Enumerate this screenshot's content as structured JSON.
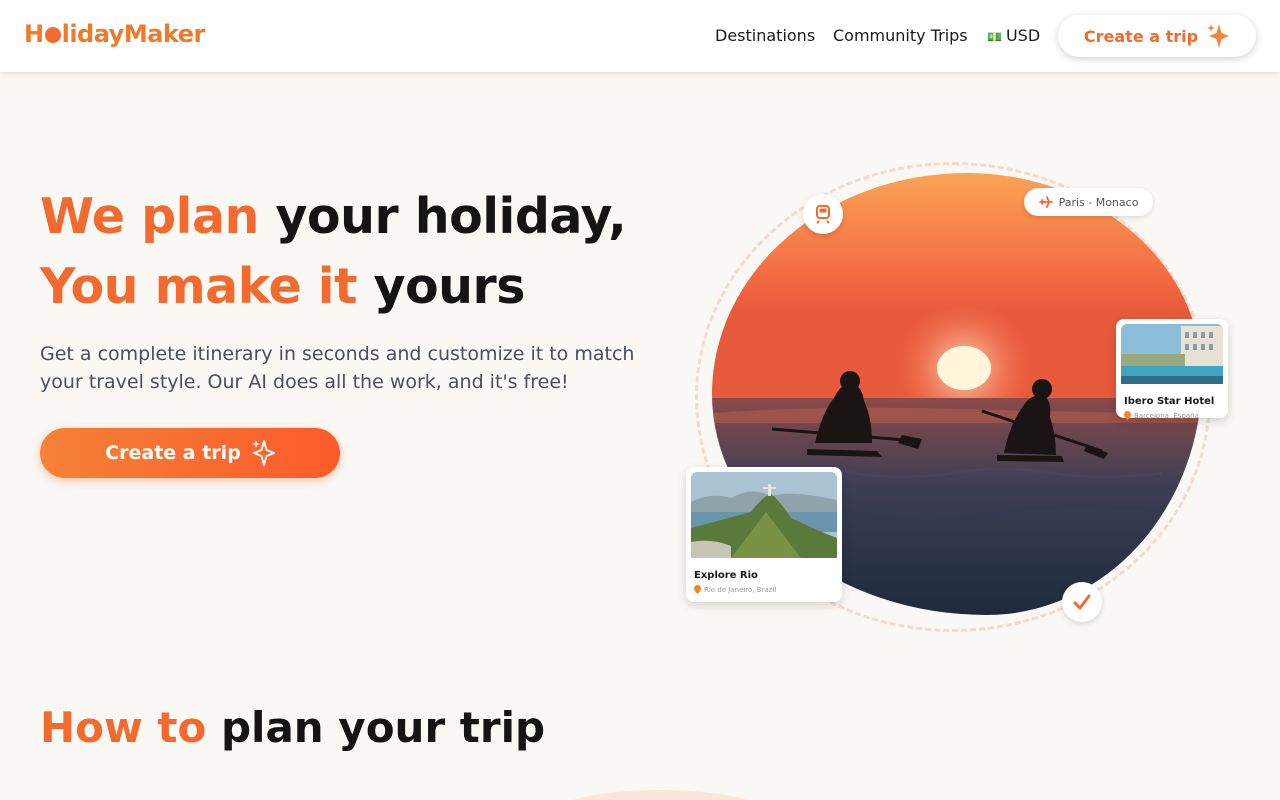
{
  "brand": {
    "name": "HolidayMaker",
    "name_pre": "H",
    "name_post": "lidayMaker",
    "accent_color": "#f26a2d"
  },
  "nav": {
    "destinations": "Destinations",
    "community_trips": "Community Trips",
    "currency": "USD",
    "currency_icon": "money-icon",
    "create_trip": "Create a trip"
  },
  "hero": {
    "line1_accent": "We plan",
    "line1_rest": "your holiday,",
    "line2_accent": "You make it",
    "line2_rest": "yours",
    "subtitle": "Get a complete itinerary in seconds and customize it to match your travel style. Our AI does all the work, and it's free!",
    "cta": "Create a trip"
  },
  "illustration": {
    "route_pill": "Paris - Monaco",
    "hotel_card": {
      "title": "Ibero Star Hotel",
      "location": "Barcelona, España"
    },
    "rio_card": {
      "title": "Explore Rio",
      "location": "Rio de Janeiro, Brazil"
    },
    "icons": [
      "train-icon",
      "plane-icon",
      "checkmark-icon",
      "sparkle-icon",
      "location-pin-icon"
    ]
  },
  "how_to": {
    "title_accent": "How to",
    "title_rest": "plan your trip"
  }
}
